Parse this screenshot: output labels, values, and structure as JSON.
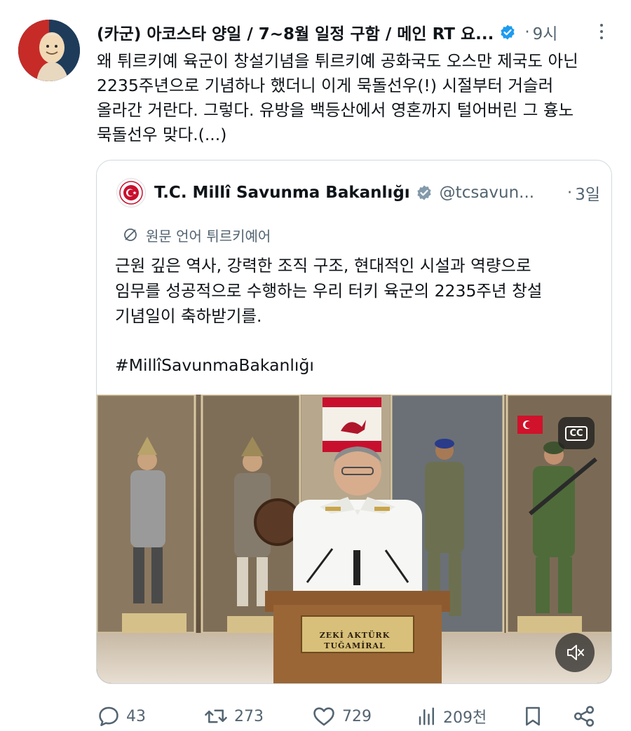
{
  "tweet": {
    "author_name": "(카군) 아코스타 양일 / 7~8월 일정 구함 / 메인 RT 요...",
    "dot": "·",
    "time": "9시",
    "text": "왜 튀르키예 육군이 창설기념을 튀르키예 공화국도 오스만 제국도 아닌\n2235주년으로 기념하나 했더니 이게 묵돌선우(!) 시절부터 거슬러\n올라간 거란다. 그렇다. 유방을 백등산에서 영혼까지 털어버린 그 흉노\n묵돌선우 맞다.(...)"
  },
  "quote": {
    "author_name": "T.C. Millî Savunma Bakanlığı",
    "handle": "@tcsavun...",
    "dot": "·",
    "time": "3일",
    "translate_label": "원문 언어 튀르키예어",
    "text": "근원 깊은 역사, 강력한 조직 구조, 현대적인 시설과 역량으로\n임무를 성공적으로 수행하는 우리 터키 육군의 2235주년 창설\n기념일이 축하받기를.",
    "hashtag": "#MillîSavunmaBakanlığı",
    "media": {
      "cc_label": "CC",
      "plaque_text": "ZEKİ AKTÜRK\nTUĞAMİRAL"
    }
  },
  "actions": {
    "replies": "43",
    "retweets": "273",
    "likes": "729",
    "views": "209천"
  },
  "colors": {
    "verified": "#1d9bf0",
    "secondary_text": "#536471",
    "border": "#cfd9de"
  },
  "icons": [
    "verified-badge-icon",
    "more-icon",
    "translate-icon",
    "reply-icon",
    "retweet-icon",
    "like-icon",
    "views-icon",
    "bookmark-icon",
    "share-icon",
    "mute-icon",
    "cc-icon"
  ]
}
